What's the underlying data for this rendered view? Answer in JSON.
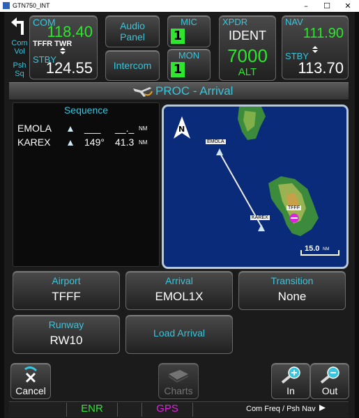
{
  "window": {
    "title": "GTN750_INT",
    "minimize": "–",
    "maximize": "☐",
    "close": "✕"
  },
  "colors": {
    "cyan": "#39c5dc",
    "green": "#2ee62e",
    "magenta": "#e020e0",
    "map_water": "#0a2a7a"
  },
  "top": {
    "com": {
      "label": "COM",
      "active": "118.40",
      "station": "TFFR TWR",
      "stby_label": "STBY",
      "standby": "124.55",
      "swap_icon": "swap-arrows-icon"
    },
    "side": {
      "line1": "Com",
      "line2": "Vol",
      "line3": "Psh",
      "line4": "Sq",
      "back_icon": "back-arrow-icon"
    },
    "audio_panel": {
      "line1": "Audio",
      "line2": "Panel"
    },
    "intercom": "Intercom",
    "mic": {
      "label": "MIC",
      "value": "1"
    },
    "mon": {
      "label": "MON",
      "value": "1"
    },
    "xpdr": {
      "label": "XPDR",
      "mode": "IDENT",
      "code": "7000",
      "alt": "ALT"
    },
    "nav": {
      "label": "NAV",
      "active": "111.90",
      "stby_label": "STBY",
      "standby": "113.70",
      "swap_icon": "swap-arrows-icon"
    }
  },
  "page": {
    "title": "PROC - Arrival",
    "icon": "procedure-plane-icon"
  },
  "sequence": {
    "caption": "Sequence",
    "rows": [
      {
        "name": "EMOLA",
        "dtk": "___",
        "dist": "__._",
        "unit": "NM",
        "leg_icon": "leg-arrow-icon"
      },
      {
        "name": "KAREX",
        "dtk": "149°",
        "dist": "41.3",
        "unit": "NM",
        "leg_icon": "leg-arrow-icon"
      }
    ]
  },
  "map": {
    "north": "N",
    "waypoints": {
      "emola": "EMOLA",
      "karex": "KAREX",
      "airport": "TFFF"
    },
    "scale": {
      "value": "15.0",
      "unit": "NM"
    }
  },
  "buttons": {
    "airport": {
      "label": "Airport",
      "value": "TFFF"
    },
    "arrival": {
      "label": "Arrival",
      "value": "EMOL1X"
    },
    "transition": {
      "label": "Transition",
      "value": "None"
    },
    "runway": {
      "label": "Runway",
      "value": "RW10"
    },
    "load": {
      "label": "Load Arrival"
    }
  },
  "softkeys": {
    "cancel": "Cancel",
    "charts": "Charts",
    "zoom_in": "In",
    "zoom_out": "Out"
  },
  "status": {
    "enr": "ENR",
    "gps": "GPS",
    "hint": "Com Freq / Psh Nav"
  }
}
